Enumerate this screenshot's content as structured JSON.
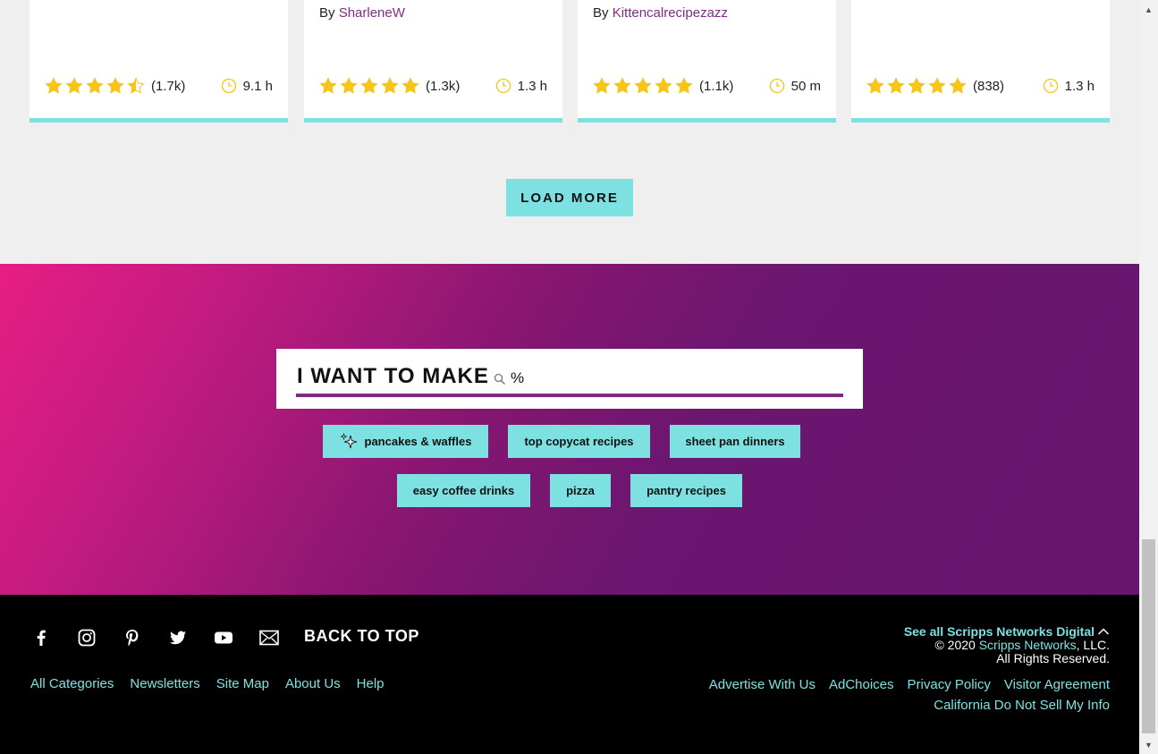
{
  "cards": [
    {
      "author_prefix": "",
      "author": "",
      "rating_count": "(1.7k)",
      "time": "9.1 h",
      "rating": 4.5
    },
    {
      "author_prefix": "By ",
      "author": "SharleneW",
      "rating_count": "(1.3k)",
      "time": "1.3 h",
      "rating": 5
    },
    {
      "author_prefix": "By ",
      "author": "Kittencalrecipezazz",
      "rating_count": "(1.1k)",
      "time": "50 m",
      "rating": 5
    },
    {
      "author_prefix": "",
      "author": "",
      "rating_count": "(838)",
      "time": "1.3 h",
      "rating": 5
    }
  ],
  "load_more": "LOAD MORE",
  "search": {
    "label": "I WANT TO MAKE",
    "value": "%",
    "placeholder": ""
  },
  "chips": [
    "pancakes & waffles",
    "top copycat recipes",
    "sheet pan dinners",
    "easy coffee drinks",
    "pizza",
    "pantry recipes"
  ],
  "footer": {
    "back_to_top": "BACK TO TOP",
    "links": [
      "All Categories",
      "Newsletters",
      "Site Map",
      "About Us",
      "Help"
    ],
    "see_all": "See all Scripps Networks Digital",
    "copyright_prefix": "© 2020 ",
    "copyright_link": "Scripps Networks",
    "copyright_suffix": ", LLC.",
    "rights": "All Rights Reserved.",
    "legal": [
      "Advertise With Us",
      "AdChoices",
      "Privacy Policy",
      "Visitor Agreement"
    ],
    "ccpa": "California Do Not Sell My Info"
  },
  "colors": {
    "accent": "#7ee1e1",
    "purple": "#7e2d7e",
    "star": "#f5c518",
    "band_start": "#e71e83",
    "band_end": "#67166e"
  },
  "icons": [
    "star-icon",
    "clock-icon",
    "search-icon",
    "sparkle-icon",
    "facebook-icon",
    "instagram-icon",
    "pinterest-icon",
    "twitter-icon",
    "youtube-icon",
    "mail-icon",
    "chevron-up-icon"
  ]
}
